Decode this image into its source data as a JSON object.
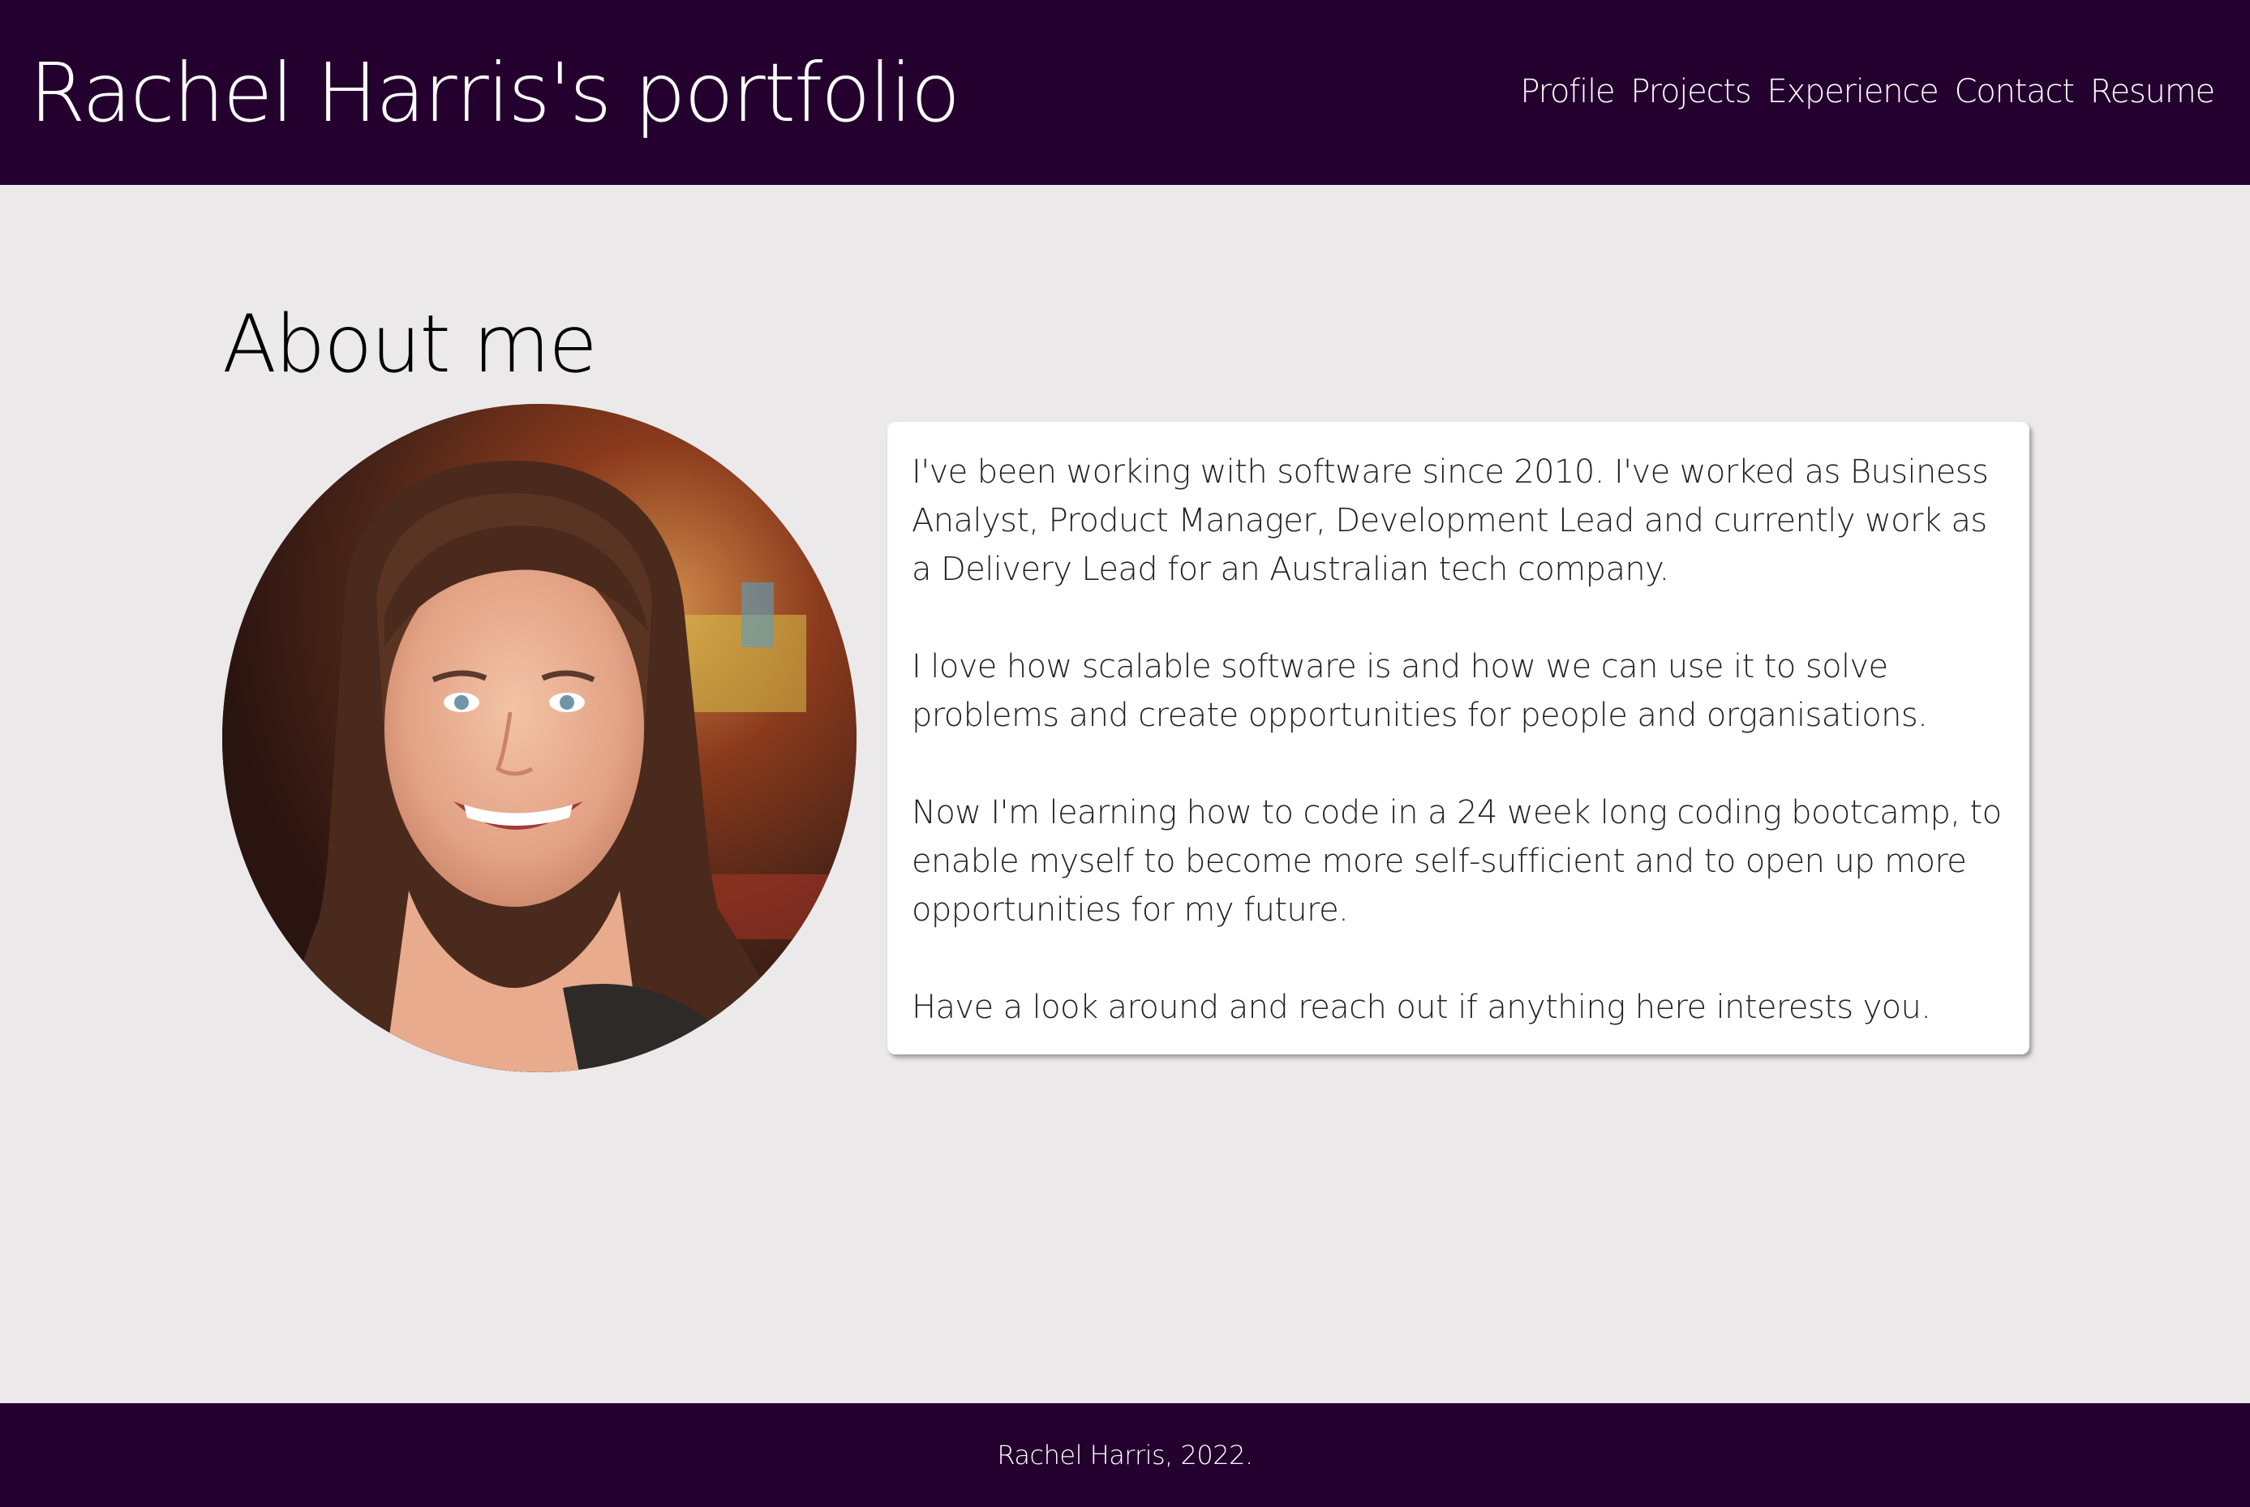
{
  "header": {
    "title": "Rachel Harris's portfolio",
    "nav": [
      "Profile",
      "Projects",
      "Experience",
      "Contact",
      "Resume"
    ]
  },
  "about": {
    "heading": "About me",
    "paragraphs": [
      "I've been working with software since 2010. I've worked as Business Analyst, Product Manager, Development Lead and currently work as a Delivery Lead for an Australian tech company.",
      "I love how scalable software is and how we can use it to solve problems and create opportunities for people and organisations.",
      "Now I'm learning how to code in a 24 week long coding bootcamp, to enable myself to become more self-sufficient and to open up more opportunities for my future.",
      "Have a look around and reach out if anything here interests you."
    ]
  },
  "footer": {
    "text": "Rachel Harris, 2022."
  },
  "colors": {
    "header_bg": "#24002e",
    "page_bg": "#ebe9ea",
    "card_bg": "#ffffff"
  }
}
